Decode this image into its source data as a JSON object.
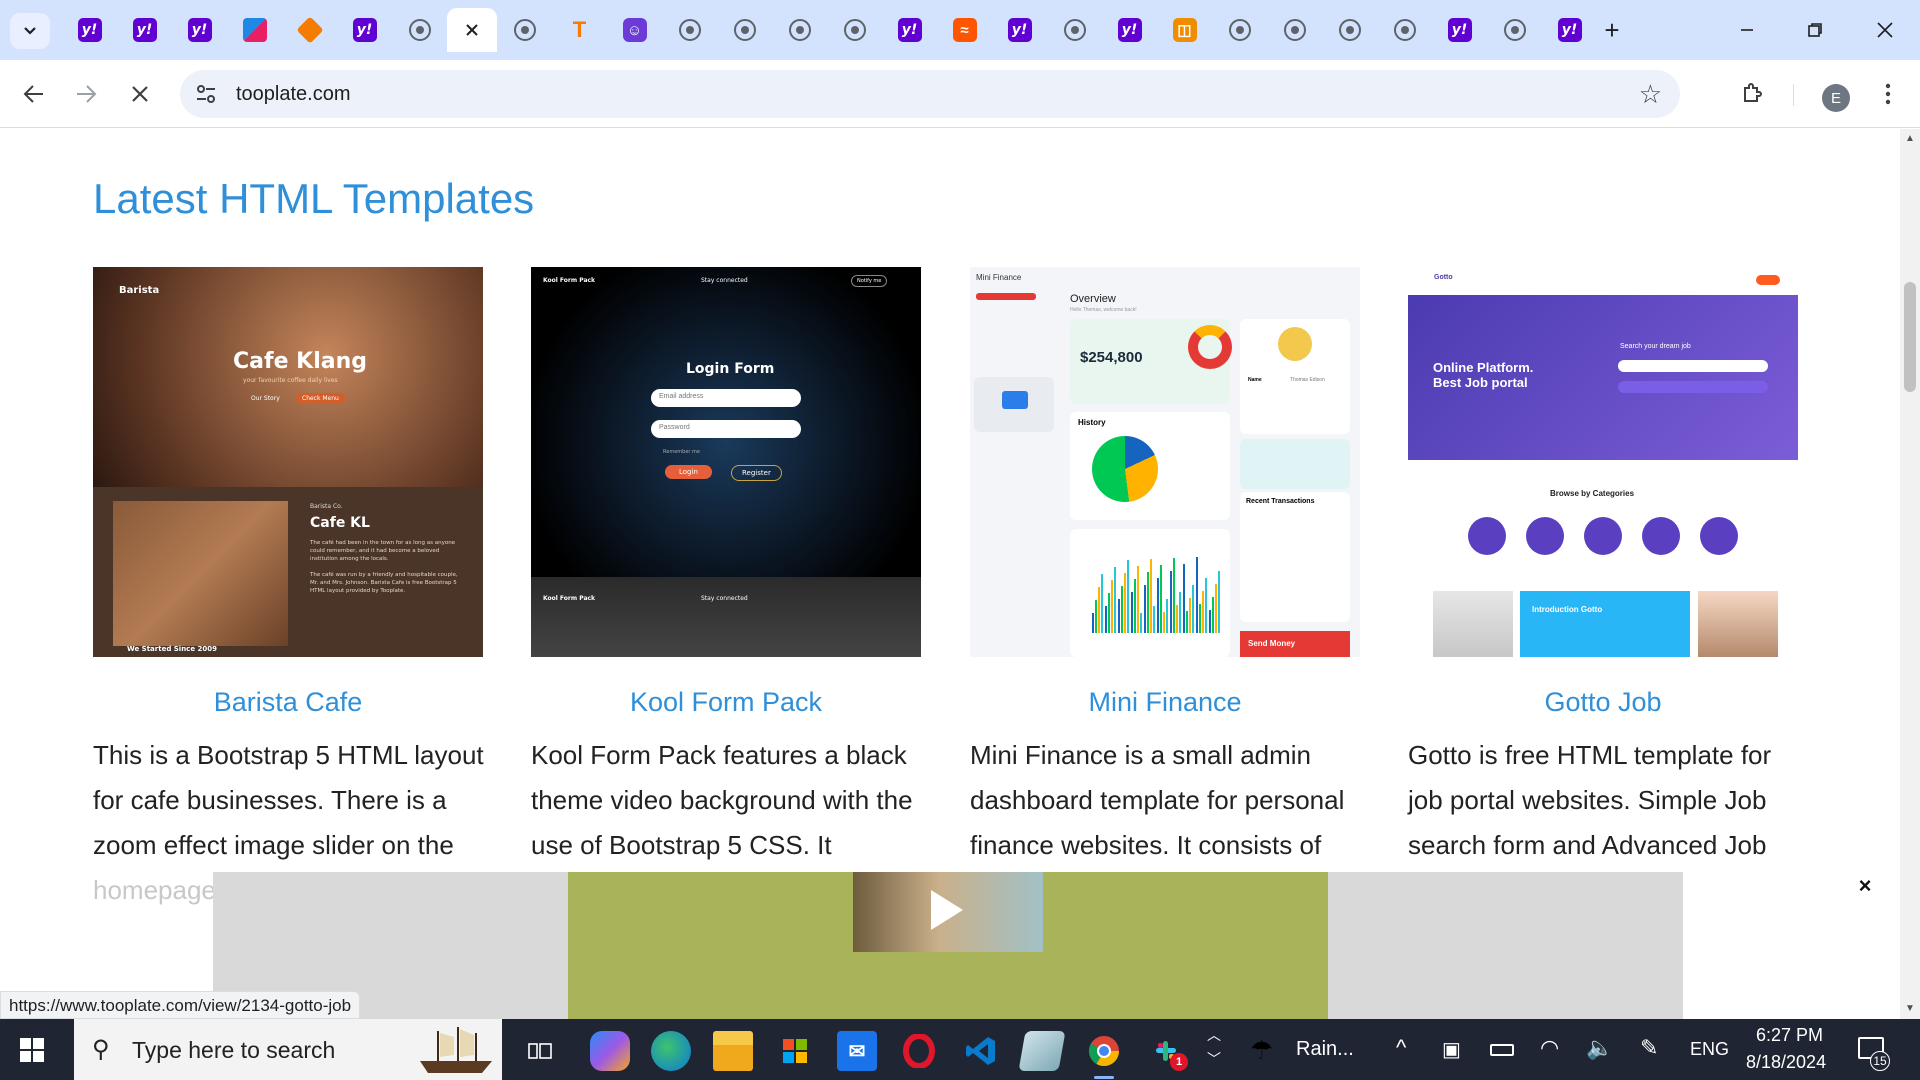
{
  "browser": {
    "url": "tooplate.com",
    "status_url": "https://www.tooplate.com/view/2134-gotto-job",
    "profile_initial": "E"
  },
  "page": {
    "heading": "Latest HTML Templates",
    "cards": [
      {
        "title": "Barista Cafe",
        "desc": "This is a Bootstrap 5 HTML layout for cafe businesses. There is a zoom effect image slider on the",
        "desc_fade": "homepage."
      },
      {
        "title": "Kool Form Pack",
        "desc": "Kool Form Pack features a black theme video background with the use of Bootstrap 5 CSS. It includes",
        "desc_fade": ""
      },
      {
        "title": "Mini Finance",
        "desc": "Mini Finance is a small admin dashboard template for personal finance websites. It consists of total",
        "desc_fade": ""
      },
      {
        "title": "Gotto Job",
        "desc": "Gotto is free HTML template for job portal websites. Simple Job search form and Advanced Job search form",
        "desc_fade": ""
      }
    ],
    "thumbs": {
      "barista": {
        "brand": "Barista",
        "hero_title": "Cafe Klang",
        "hero_sub": "your favourite coffee daily lives",
        "btn1": "Our Story",
        "btn2": "Check Menu",
        "section_brand": "Barista Co.",
        "section_title": "Cafe KL",
        "p1": "The café had been in the town for as long as anyone could remember, and it had become a beloved institution among the locals.",
        "p2": "The café was run by a friendly and hospitable couple, Mr. and Mrs. Johnson. Barista Cafe is free Bootstrap 5 HTML layout provided by Tooplate.",
        "since": "We Started Since 2009"
      },
      "kool": {
        "brand": "Kool Form Pack",
        "stay": "Stay connected",
        "notify": "Notify me",
        "form_title": "Login Form",
        "email": "Email address",
        "password": "Password",
        "remember": "Remember me",
        "login": "Login",
        "register": "Register"
      },
      "mini": {
        "brand": "Mini Finance",
        "overview": "Overview",
        "welcome": "Hello Thomas, welcome back!",
        "balance": "$254,800",
        "history": "History",
        "recent": "Recent Transactions",
        "send": "Send Money",
        "name_label": "Name",
        "name_value": "Thomas Edison"
      },
      "gotto": {
        "brand": "Gotto",
        "hero": "Online Platform. Best Job portal",
        "search": "Search your dream job",
        "browse": "Browse by Categories",
        "intro": "Introduction Gotto"
      }
    }
  },
  "taskbar": {
    "search_placeholder": "Type here to search",
    "weather": "Rain...",
    "lang": "ENG",
    "time": "6:27 PM",
    "date": "8/18/2024",
    "notifications": "15",
    "slack_badge": "1"
  }
}
